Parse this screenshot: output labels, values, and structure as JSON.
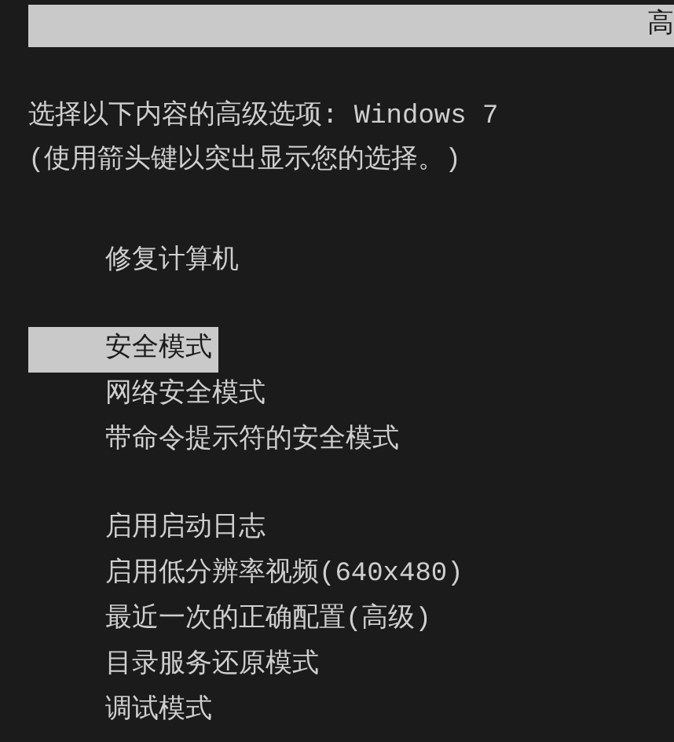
{
  "title_bar": {
    "title": "高"
  },
  "prompt": [
    "选择以下内容的高级选项: Windows 7",
    "(使用箭头键以突出显示您的选择。)"
  ],
  "groups": [
    {
      "items": [
        {
          "label": "修复计算机",
          "selected": false
        }
      ]
    },
    {
      "items": [
        {
          "label": "安全模式",
          "selected": true
        },
        {
          "label": "网络安全模式",
          "selected": false
        },
        {
          "label": "带命令提示符的安全模式",
          "selected": false
        }
      ]
    },
    {
      "items": [
        {
          "label": "启用启动日志",
          "selected": false
        },
        {
          "label": "启用低分辨率视频(640x480)",
          "selected": false
        },
        {
          "label": "最近一次的正确配置(高级)",
          "selected": false
        },
        {
          "label": "目录服务还原模式",
          "selected": false
        },
        {
          "label": "调试模式",
          "selected": false
        }
      ]
    }
  ]
}
